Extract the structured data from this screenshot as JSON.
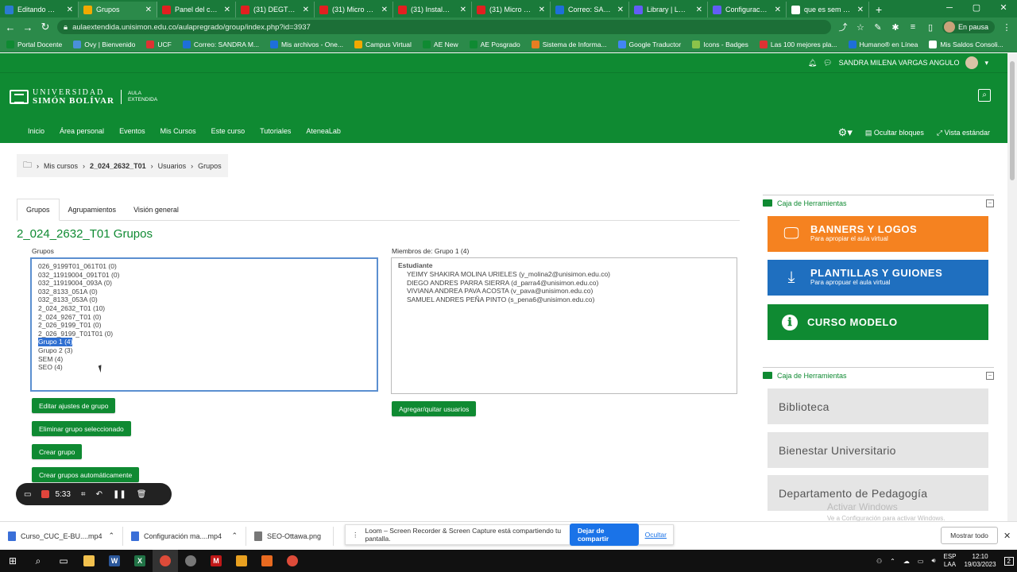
{
  "browser": {
    "tabs": [
      {
        "label": "Editando Wiki",
        "color": "#2b7bd1",
        "active": false
      },
      {
        "label": "Grupos",
        "color": "#f2a900",
        "active": true
      },
      {
        "label": "Panel del canal",
        "color": "#e02020",
        "active": false
      },
      {
        "label": "(31) DEGT - UN",
        "color": "#e02020",
        "active": false
      },
      {
        "label": "(31) Micro curs",
        "color": "#e02020",
        "active": false
      },
      {
        "label": "(31) Instalación",
        "color": "#e02020",
        "active": false
      },
      {
        "label": "(31) Micro Curs",
        "color": "#e02020",
        "active": false
      },
      {
        "label": "Correo: SANDR",
        "color": "#1e6fd9",
        "active": false
      },
      {
        "label": "Library | Loom",
        "color": "#625df5",
        "active": false
      },
      {
        "label": "Configuración a",
        "color": "#625df5",
        "active": false
      },
      {
        "label": "que es sem - Bu",
        "color": "#ffffff",
        "active": false
      }
    ],
    "url": "aulaextendida.unisimon.edu.co/aulapregrado/group/index.php?id=3937",
    "profile_status": "En pausa",
    "bookmarks": [
      {
        "label": "Portal Docente",
        "color": "#0f8a32"
      },
      {
        "label": "Ovy | Bienvenido",
        "color": "#4a90d9"
      },
      {
        "label": "UCF",
        "color": "#d33"
      },
      {
        "label": "Correo: SANDRA M...",
        "color": "#1e6fd9"
      },
      {
        "label": "Mis archivos - One...",
        "color": "#1e6fd9"
      },
      {
        "label": "Campus Virtual",
        "color": "#f2a900"
      },
      {
        "label": "AE New",
        "color": "#0f8a32"
      },
      {
        "label": "AE Posgrado",
        "color": "#0f8a32"
      },
      {
        "label": "Sistema de Informa...",
        "color": "#e67e22"
      },
      {
        "label": "Google Traductor",
        "color": "#4285f4"
      },
      {
        "label": "Icons - Badges",
        "color": "#8bc34a"
      },
      {
        "label": "Las 100 mejores pla...",
        "color": "#d33"
      },
      {
        "label": "Humano® en Línea",
        "color": "#1e6fd9"
      },
      {
        "label": "Mis Saldos Consoli...",
        "color": "#ffffff"
      }
    ]
  },
  "site": {
    "user_name": "SANDRA MILENA VARGAS ANGULO",
    "logo_line1": "UNIVERSIDAD",
    "logo_line2": "SIMÓN BOLÍVAR",
    "logo_aula": "AULA",
    "logo_extendida": "EXTENDIDA",
    "nav": [
      "Inicio",
      "Área personal",
      "Eventos",
      "Mis Cursos",
      "Este curso",
      "Tutoriales",
      "AteneaLab"
    ],
    "hide_blocks": "Ocultar bloques",
    "standard_view": "Vista estándar"
  },
  "breadcrumb": [
    "Mis cursos",
    "2_024_2632_T01",
    "Usuarios",
    "Grupos"
  ],
  "page_tabs": [
    "Grupos",
    "Agrupamientos",
    "Visión general"
  ],
  "page_title": "2_024_2632_T01 Grupos",
  "groups_label": "Grupos",
  "groups": [
    "026_9199T01_061T01 (0)",
    "032_11919004_091T01 (0)",
    "032_11919004_093A (0)",
    "032_8133_051A (0)",
    "032_8133_053A (0)",
    "2_024_2632_T01 (10)",
    "2_024_9267_T01 (0)",
    "2_026_9199_T01 (0)",
    "2_026_9199_T01T01 (0)",
    "Grupo 1 (4)",
    "Grupo 2 (3)",
    "SEM (4)",
    "SEO (4)"
  ],
  "selected_group": "Grupo 1 (4)",
  "members_label": "Miembros de: Grupo 1 (4)",
  "members_role": "Estudiante",
  "members": [
    "YEIMY SHAKIRA MOLINA URIELES (y_molina2@unisimon.edu.co)",
    "DIEGO ANDRES PARRA SIERRA (d_parra4@unisimon.edu.co)",
    "VIVIANA ANDREA PAVA ACOSTA (v_pava@unisimon.edu.co)",
    "SAMUEL ANDRES PEÑA PINTO (s_pena6@unisimon.edu.co)"
  ],
  "buttons": {
    "edit_group": "Editar ajustes de grupo",
    "delete_group": "Eliminar grupo seleccionado",
    "create_group": "Crear grupo",
    "auto_create": "Crear grupos automáticamente",
    "add_remove_users": "Agregar/quitar usuarios"
  },
  "sidebar": {
    "toolbox_title": "Caja de Herramientas",
    "banners": [
      {
        "title": "BANNERS Y LOGOS",
        "subtitle": "Para apropiar el aula virtual",
        "color": "#f58220",
        "icon": "monitor-icon"
      },
      {
        "title": "PLANTILLAS Y GUIONES",
        "subtitle": "Para apropuar el aula virtual",
        "color": "#1f6fbf",
        "icon": "download-icon"
      },
      {
        "title": "CURSO MODELO",
        "subtitle": "",
        "color": "#0f8a32",
        "icon": "info-icon"
      }
    ],
    "links": [
      "Biblioteca",
      "Bienestar Universitario",
      "Departamento de Pedagogía"
    ]
  },
  "watermark": {
    "line1": "Activar Windows",
    "line2": "Ve a Configuración para activar Windows."
  },
  "recorder": {
    "time": "5:33"
  },
  "downloads": [
    {
      "label": "Curso_CUC_E-BU....mp4",
      "color": "#3a6fd8"
    },
    {
      "label": "Configuración ma....mp4",
      "color": "#3a6fd8"
    },
    {
      "label": "SEO-Ottawa.png",
      "color": "#777"
    }
  ],
  "share_bar": {
    "message": "Loom – Screen Recorder & Screen Capture está compartiendo tu pantalla.",
    "stop_label": "Dejar de compartir",
    "hide_label": "Ocultar"
  },
  "show_all": "Mostrar todo",
  "taskbar": {
    "lang1": "ESP",
    "lang2": "LAA",
    "time": "12:10",
    "date": "19/03/2023",
    "notification_count": "2"
  }
}
